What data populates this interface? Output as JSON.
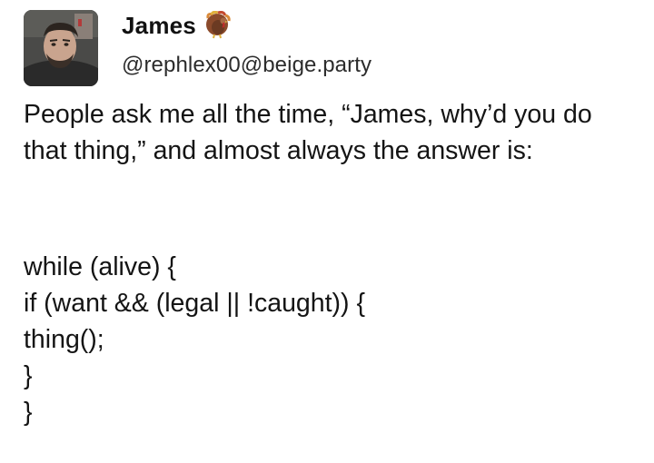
{
  "post": {
    "author": {
      "display_name": "James",
      "name_emoji": "turkey-emoji",
      "handle": "@rephlex00@beige.party"
    },
    "content": {
      "text": "People ask me all the time, “James, why’d you do that thing,” and almost always the answer is:",
      "code_lines": [
        "while (alive) {",
        "if (want && (legal || !caught)) {",
        "thing();",
        "}",
        "}"
      ]
    }
  },
  "icons": {
    "avatar": "avatar-photo",
    "emoji": "turkey-icon"
  }
}
